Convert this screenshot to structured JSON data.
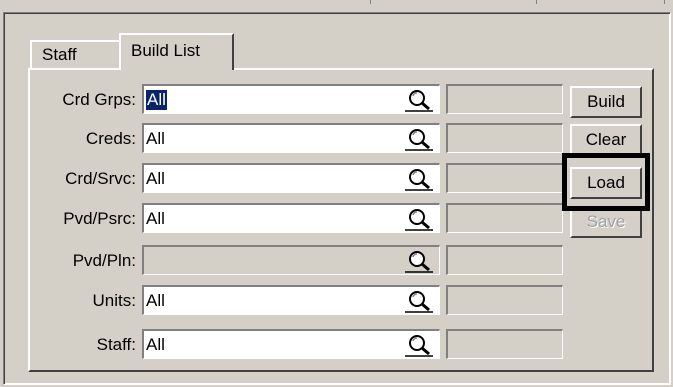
{
  "tabs": [
    {
      "label": "Staff",
      "active": false
    },
    {
      "label": "Build List",
      "active": true
    }
  ],
  "rows": [
    {
      "label": "Crd Grps:",
      "value": "All",
      "selected": true,
      "enabled": true
    },
    {
      "label": "Creds:",
      "value": "All",
      "selected": false,
      "enabled": true
    },
    {
      "label": "Crd/Srvc:",
      "value": "All",
      "selected": false,
      "enabled": true
    },
    {
      "label": "Pvd/Psrc:",
      "value": "All",
      "selected": false,
      "enabled": true
    },
    {
      "label": "Pvd/Pln:",
      "value": "",
      "selected": false,
      "enabled": false
    },
    {
      "label": "Units:",
      "value": "All",
      "selected": false,
      "enabled": true
    },
    {
      "label": "Staff:",
      "value": "All",
      "selected": false,
      "enabled": true
    }
  ],
  "buttons": {
    "build": "Build",
    "clear": "Clear",
    "load": "Load",
    "save": "Save"
  },
  "icons": {
    "lookup": "magnifier-icon"
  },
  "colors": {
    "face": "#d4d0c8",
    "selection": "#0a246a",
    "highlight_box": "#000000"
  }
}
